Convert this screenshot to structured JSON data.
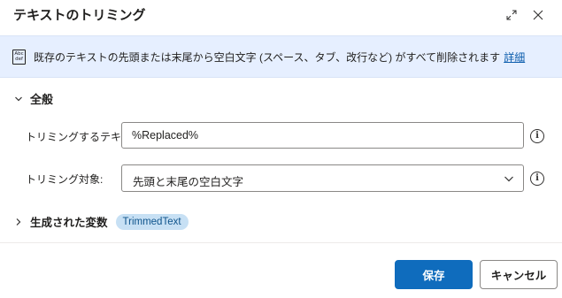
{
  "dialog": {
    "title": "テキストのトリミング"
  },
  "banner": {
    "icon": "abc-def-icon",
    "icon_line1": "Abc",
    "icon_line2": "def",
    "text": "既存のテキストの先頭または末尾から空白文字 (スペース、タブ、改行など) がすべて削除されます",
    "link": "詳細"
  },
  "general": {
    "header": "全般",
    "text_to_trim": {
      "label": "トリミングするテキスト:",
      "value": "%Replaced%"
    },
    "trim_target": {
      "label": "トリミング対象:",
      "value": "先頭と末尾の空白文字"
    }
  },
  "variables": {
    "header": "生成された変数",
    "chip": "TrimmedText"
  },
  "footer": {
    "save_label": "保存",
    "cancel_label": "キャンセル"
  },
  "colors": {
    "accent": "#0f6cbd",
    "banner_bg": "#e6efff",
    "chip_bg": "#c7e0f4",
    "link": "#0b5cad"
  }
}
